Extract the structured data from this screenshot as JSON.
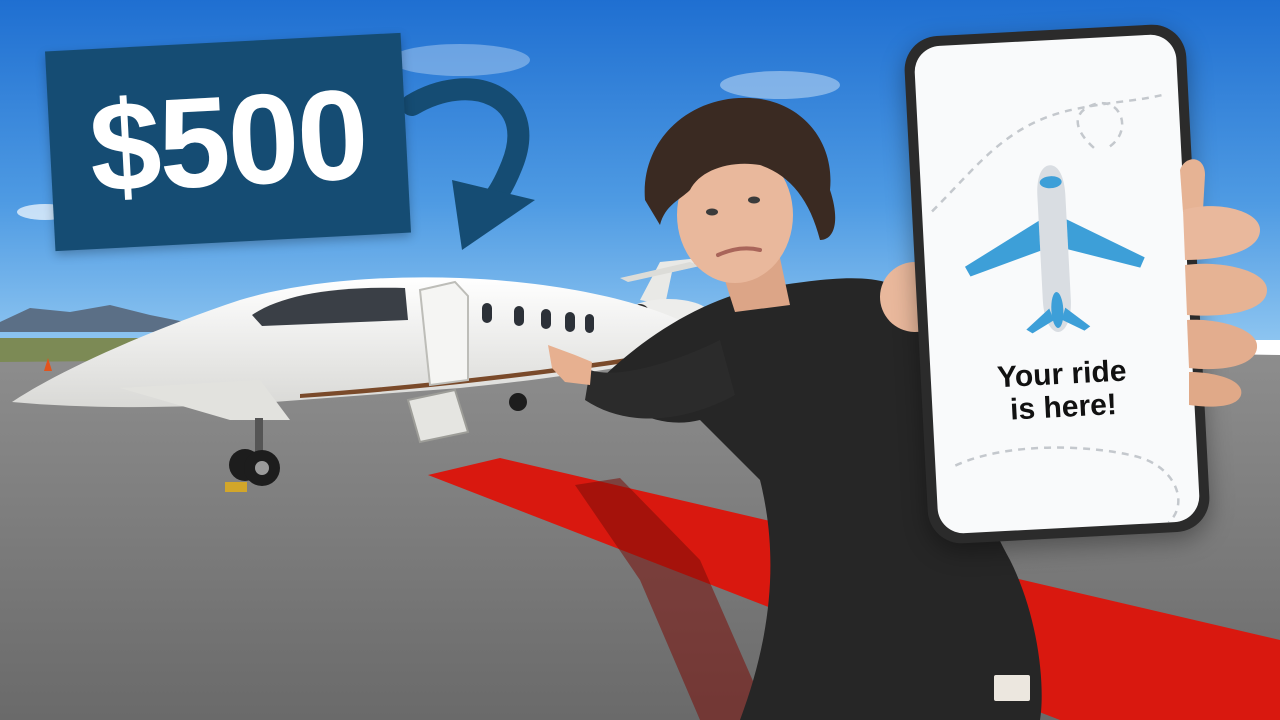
{
  "thumbnail": {
    "price_label": "$500",
    "phone_message_line1": "Your ride",
    "phone_message_line2": "is here!",
    "icons": {
      "arrow": "curved-arrow-icon",
      "plane": "airplane-icon"
    },
    "colors": {
      "price_tag_bg": "#154c73",
      "price_text": "#ffffff",
      "arrow": "#154c73",
      "sky_top": "#1f6fd1",
      "sky_bottom": "#8cc4f0",
      "tarmac": "#7d7d7d",
      "red_carpet": "#d9180f",
      "jet_body": "#f3f3f1",
      "jacket": "#262626",
      "plane_icon_blue": "#3d9fd8",
      "plane_icon_body": "#d9dde2"
    }
  }
}
